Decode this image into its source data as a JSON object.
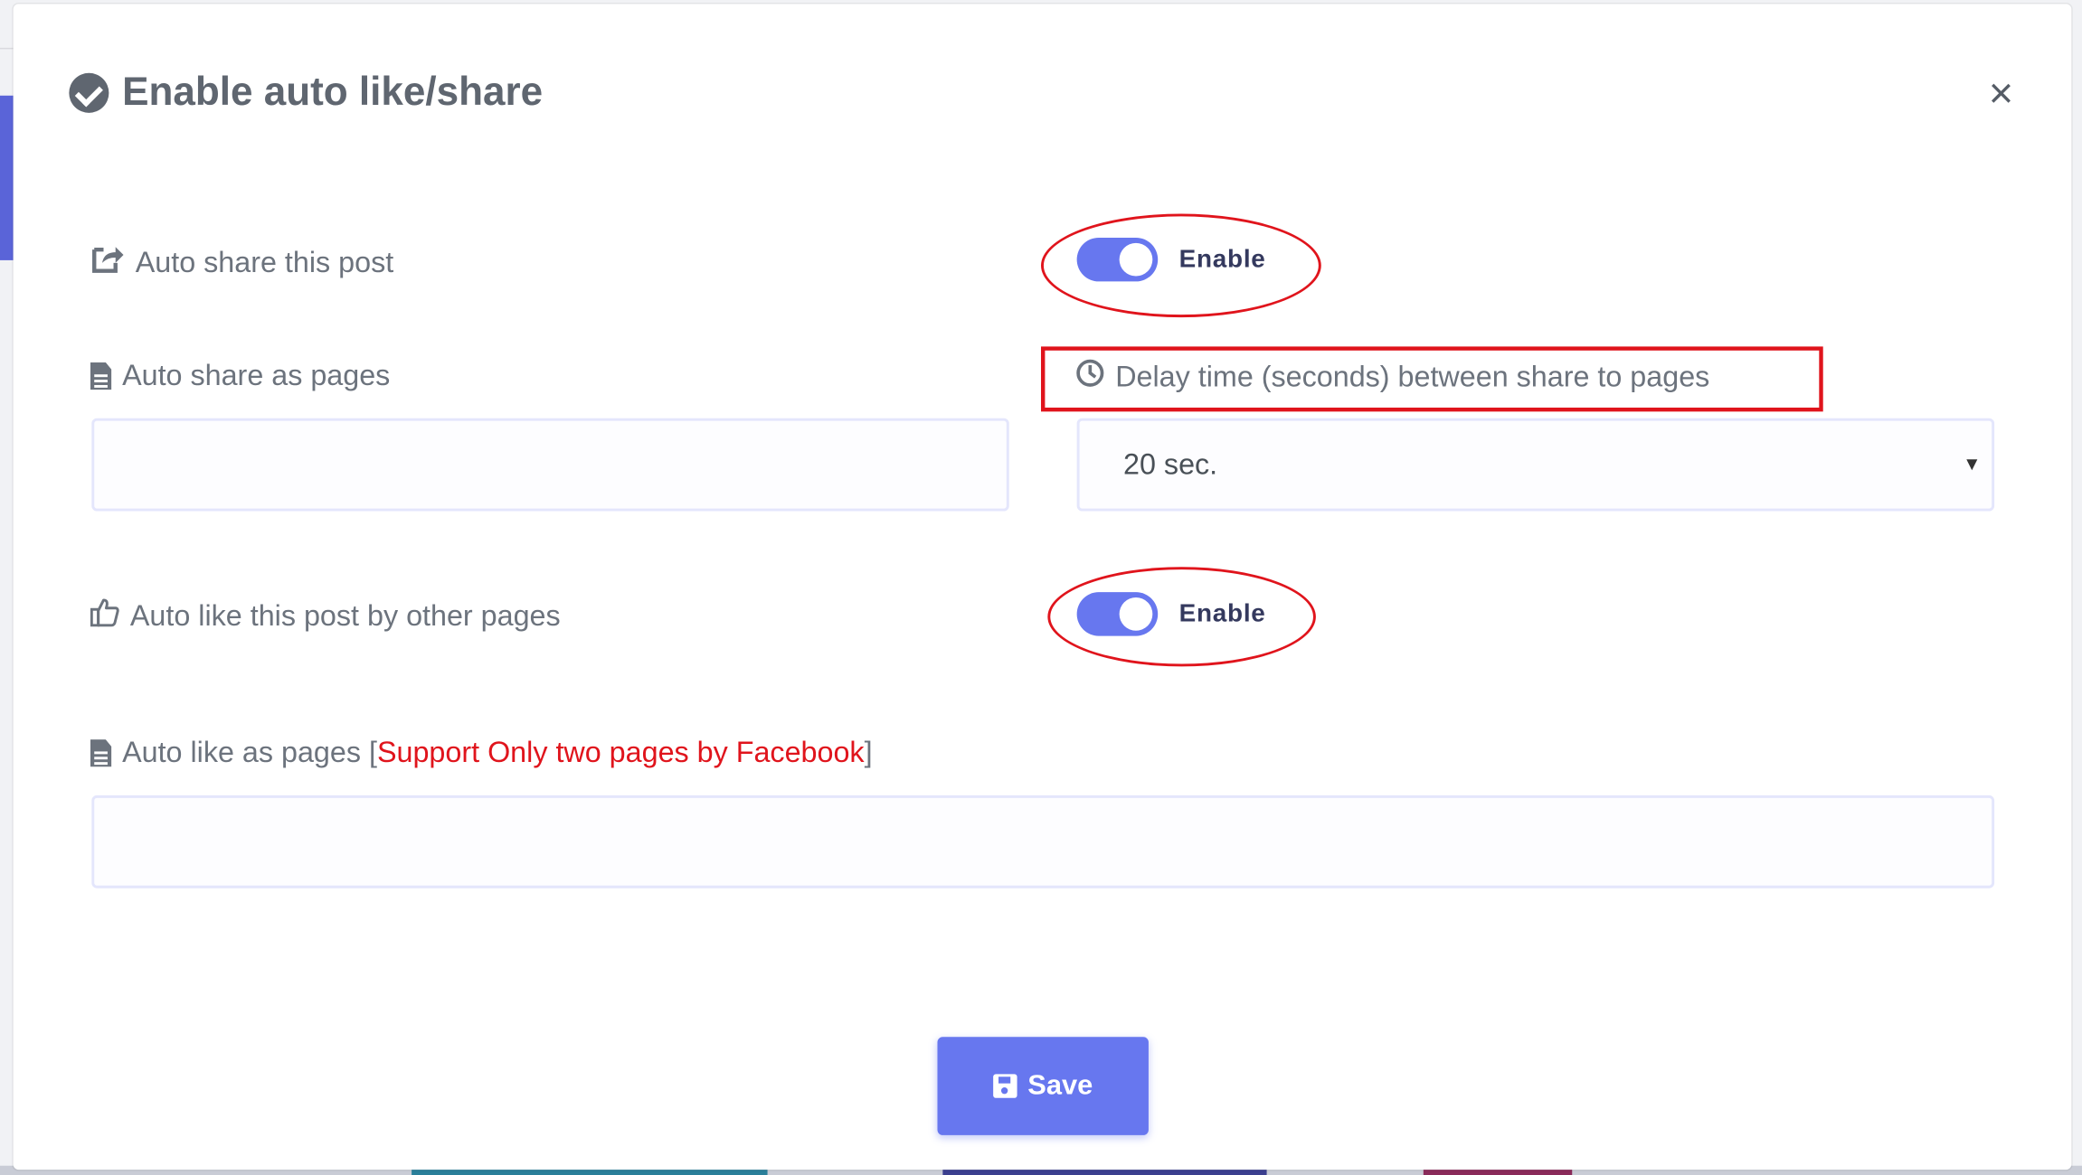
{
  "modal": {
    "title": "Enable auto like/share",
    "close_label": "×"
  },
  "auto_share": {
    "label": "Auto share this post",
    "toggle_label": "Enable",
    "toggle_on": true
  },
  "share_pages": {
    "label": "Auto share as pages",
    "value": ""
  },
  "delay": {
    "label": "Delay time (seconds) between share to pages",
    "selected": "20 sec."
  },
  "auto_like": {
    "label": "Auto like this post by other pages",
    "toggle_label": "Enable",
    "toggle_on": true
  },
  "like_pages": {
    "label_prefix": "Auto like as pages [",
    "label_warning": "Support Only two pages by Facebook",
    "label_suffix": "]",
    "value": ""
  },
  "actions": {
    "save_label": "Save"
  },
  "colors": {
    "accent": "#6777ef",
    "annotation": "#e0141c",
    "label_text": "#6c737d"
  }
}
